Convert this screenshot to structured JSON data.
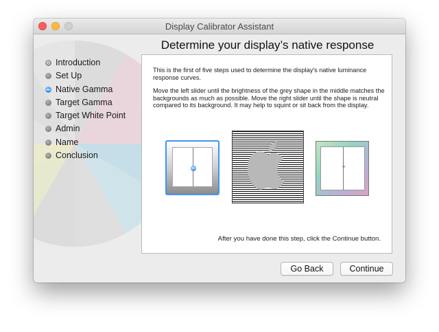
{
  "window": {
    "title": "Display Calibrator Assistant"
  },
  "sidebar": {
    "steps": [
      {
        "label": "Introduction",
        "state": "done"
      },
      {
        "label": "Set Up",
        "state": "pending"
      },
      {
        "label": "Native Gamma",
        "state": "current"
      },
      {
        "label": "Target Gamma",
        "state": "pending"
      },
      {
        "label": "Target White Point",
        "state": "pending"
      },
      {
        "label": "Admin",
        "state": "pending"
      },
      {
        "label": "Name",
        "state": "pending"
      },
      {
        "label": "Conclusion",
        "state": "pending"
      }
    ]
  },
  "main": {
    "heading": "Determine your display’s native response",
    "paragraph1": "This is the first of five steps used to determine the display's native luminance response curves.",
    "paragraph2": "Move the left slider until the brightness of the grey shape in the middle matches the backgrounds as much as possible.  Move the right slider until the shape is neutral compared to its background.  It may help to squint or sit back from the display.",
    "footer": "After you have done this step, click the Continue button.",
    "crosshair": "+"
  },
  "buttons": {
    "back": "Go Back",
    "continue": "Continue"
  },
  "colors": {
    "accent": "#3f95f0",
    "close": "#fc605c",
    "minimize": "#fdbc40",
    "zoom_disabled": "#d0d0d0"
  },
  "icons": {
    "close": "close-button-icon",
    "minimize": "minimize-button-icon",
    "zoom": "zoom-button-icon",
    "wheel": "color-wheel-icon",
    "apple": "apple-logo-icon",
    "slider": "slider-knob-icon"
  }
}
